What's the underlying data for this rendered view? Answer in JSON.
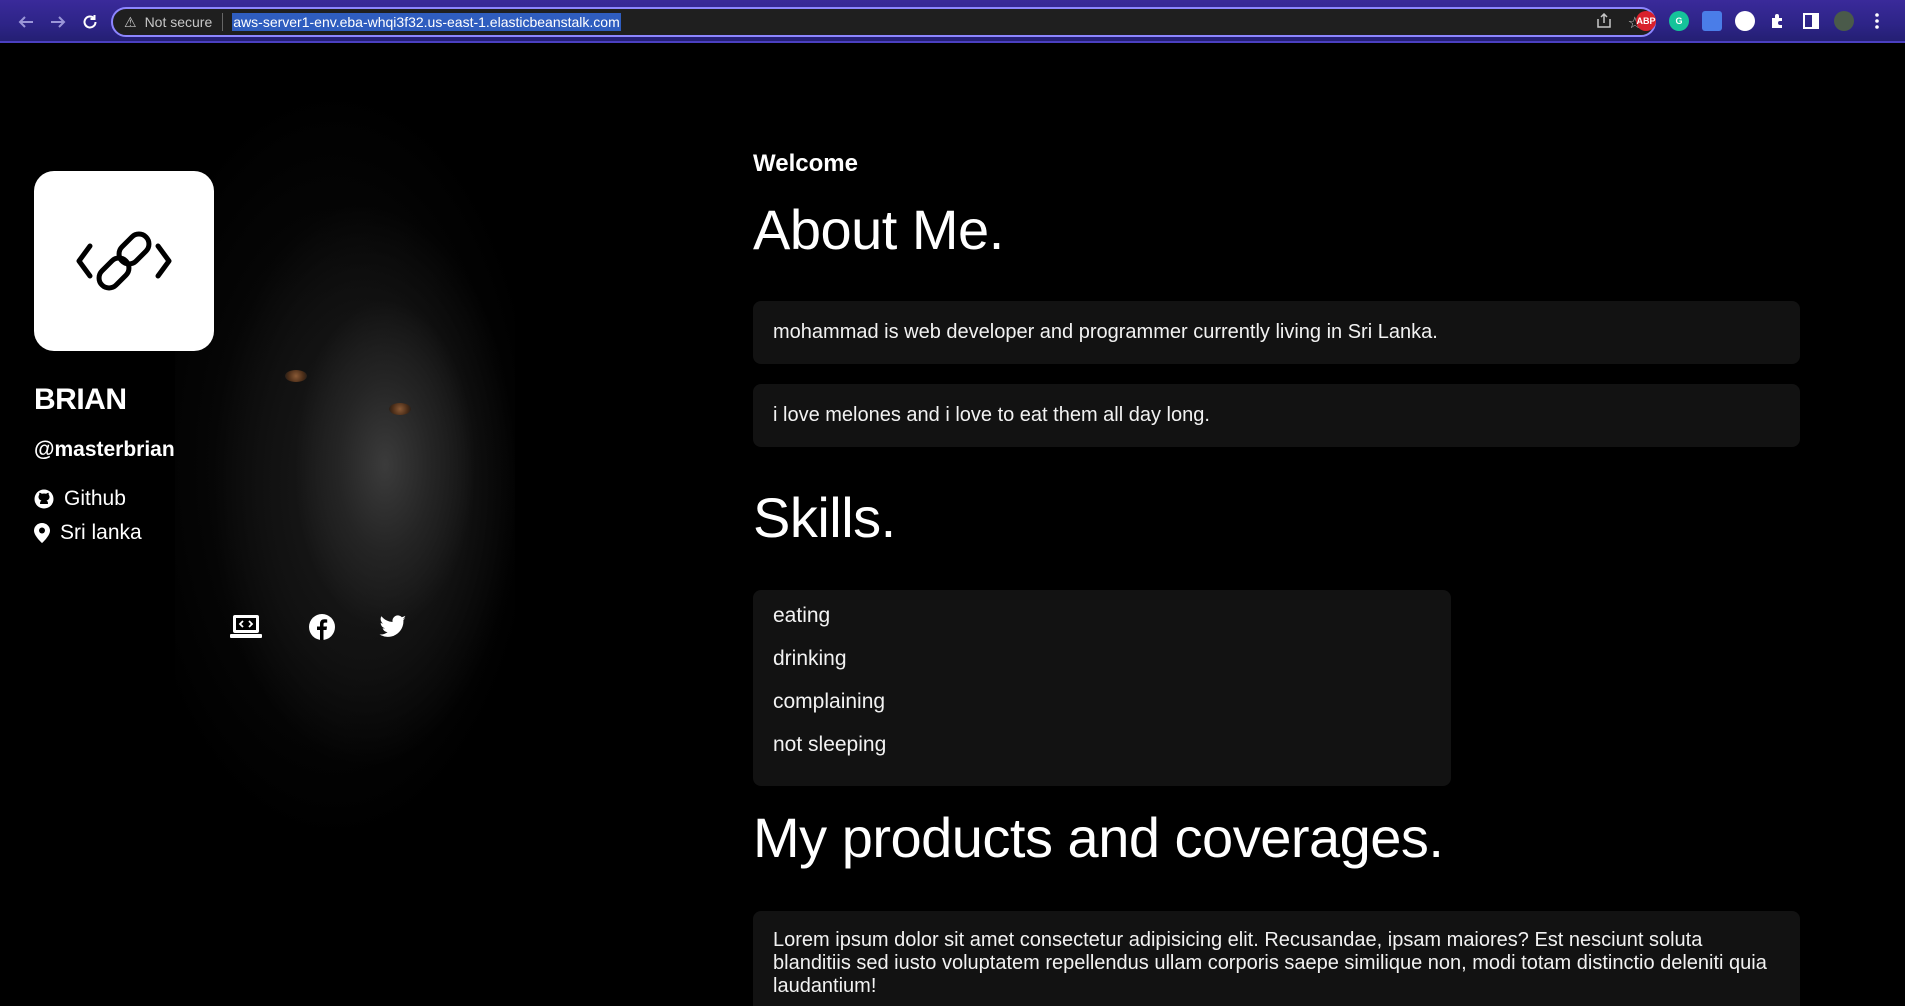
{
  "browser": {
    "security_label": "Not secure",
    "url": "aws-server1-env.eba-whqi3f32.us-east-1.elasticbeanstalk.com",
    "extensions": [
      {
        "label": "ABP",
        "color": "#d9212c"
      },
      {
        "label": "G",
        "color": "#15c39a"
      },
      {
        "label": "",
        "color": "#4a7de8"
      },
      {
        "label": "",
        "color": "#ffffff"
      }
    ]
  },
  "profile": {
    "name": "BRIAN",
    "handle": "@masterbrian",
    "github_label": "Github",
    "location_label": "Sri lanka"
  },
  "main": {
    "welcome": "Welcome",
    "about_heading": "About Me.",
    "about_lines": [
      "mohammad is web developer and programmer currently living in Sri Lanka.",
      "i love melones and i love to eat them all day long."
    ],
    "skills_heading": "Skills.",
    "skills": [
      "eating",
      "drinking",
      "complaining",
      "not sleeping"
    ],
    "products_heading": "My products and coverages.",
    "products_text": "Lorem ipsum dolor sit amet consectetur adipisicing elit. Recusandae, ipsam maiores? Est nesciunt soluta blanditiis sed iusto voluptatem repellendus ullam corporis saepe similique non, modi totam distinctio deleniti quia laudantium!"
  },
  "colors": {
    "background": "#000000",
    "card": "#121212",
    "chrome": "#2d2487",
    "url_highlight": "#2f5dbf"
  }
}
